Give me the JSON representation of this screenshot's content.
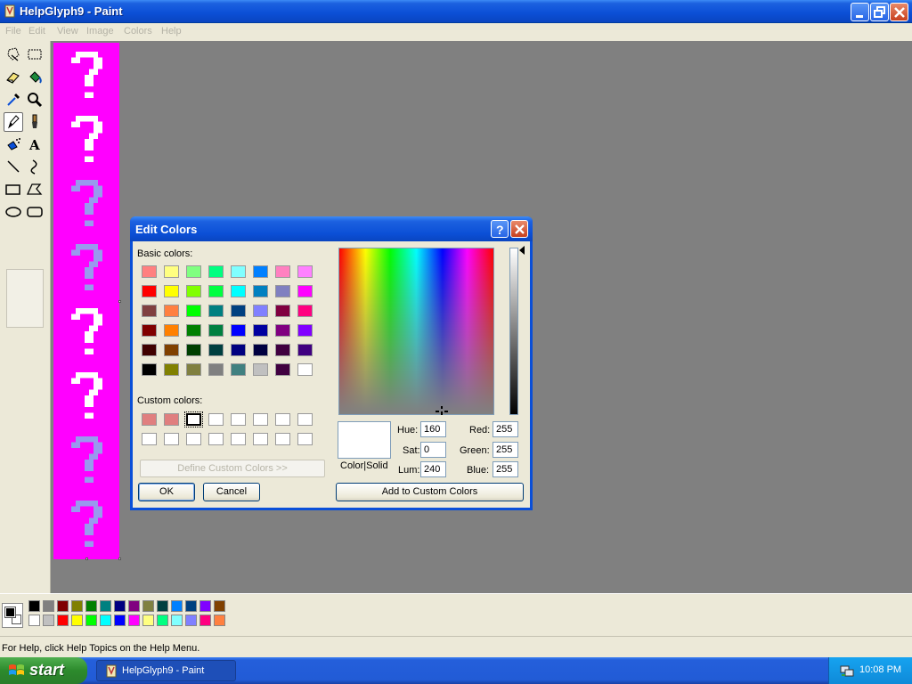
{
  "window": {
    "title": "HelpGlyph9 - Paint"
  },
  "menu": [
    "File",
    "Edit",
    "View",
    "Image",
    "Colors",
    "Help"
  ],
  "tools": [
    "free-form-select",
    "select",
    "eraser",
    "fill",
    "pick-color",
    "magnifier",
    "pencil",
    "brush",
    "airbrush",
    "text",
    "line",
    "curve",
    "rectangle",
    "polygon",
    "ellipse",
    "rounded-rectangle"
  ],
  "status": {
    "text": "For Help, click Help Topics on the Help Menu."
  },
  "palette": {
    "top": [
      "#000000",
      "#808080",
      "#800000",
      "#808000",
      "#008000",
      "#008080",
      "#000080",
      "#800080",
      "#808040",
      "#004040",
      "#0080ff",
      "#004080",
      "#8000ff",
      "#804000"
    ],
    "bottom": [
      "#ffffff",
      "#c0c0c0",
      "#ff0000",
      "#ffff00",
      "#00ff00",
      "#00ffff",
      "#0000ff",
      "#ff00ff",
      "#ffff80",
      "#00ff80",
      "#80ffff",
      "#8080ff",
      "#ff0080",
      "#ff8040"
    ]
  },
  "taskbar": {
    "start_label": "start",
    "task_label": "HelpGlyph9 - Paint",
    "clock": "10:08 PM"
  },
  "dialog": {
    "title": "Edit Colors",
    "basic_colors_label": "Basic colors:",
    "custom_colors_label": "Custom colors:",
    "define_button": "Define Custom Colors >>",
    "ok_label": "OK",
    "cancel_label": "Cancel",
    "color_solid_label": "Color|Solid",
    "add_custom_button": "Add to Custom Colors",
    "hue_label": "Hue:",
    "hue_value": "160",
    "sat_label": "Sat:",
    "sat_value": "0",
    "lum_label": "Lum:",
    "lum_value": "240",
    "red_label": "Red:",
    "red_value": "255",
    "green_label": "Green:",
    "green_value": "255",
    "blue_label": "Blue:",
    "blue_value": "255",
    "basic_colors": [
      [
        "#ff8080",
        "#ffff80",
        "#80ff80",
        "#00ff80",
        "#80ffff",
        "#0080ff",
        "#ff80c0",
        "#ff80ff"
      ],
      [
        "#ff0000",
        "#ffff00",
        "#80ff00",
        "#00ff40",
        "#00ffff",
        "#0080c0",
        "#8080c0",
        "#ff00ff"
      ],
      [
        "#804040",
        "#ff8040",
        "#00ff00",
        "#008080",
        "#004080",
        "#8080ff",
        "#800040",
        "#ff0080"
      ],
      [
        "#800000",
        "#ff8000",
        "#008000",
        "#008040",
        "#0000ff",
        "#0000a0",
        "#800080",
        "#8000ff"
      ],
      [
        "#400000",
        "#804000",
        "#004000",
        "#004040",
        "#000080",
        "#000040",
        "#400040",
        "#400080"
      ],
      [
        "#000000",
        "#808000",
        "#808040",
        "#808080",
        "#408080",
        "#c0c0c0",
        "#400040",
        "#ffffff"
      ]
    ],
    "custom_colors": [
      [
        "#e07f7f",
        "#e07f7f",
        "#ffffff",
        "#ffffff",
        "#ffffff",
        "#ffffff",
        "#ffffff",
        "#ffffff"
      ],
      [
        "#ffffff",
        "#ffffff",
        "#ffffff",
        "#ffffff",
        "#ffffff",
        "#ffffff",
        "#ffffff",
        "#ffffff"
      ]
    ],
    "custom_selected": [
      0,
      2
    ]
  },
  "glyphs": [
    "#ffffff",
    "#ffffff",
    "#9999ee",
    "#9999ee",
    "#ffffff",
    "#ffffff",
    "#9999ee",
    "#9999ee"
  ],
  "colors": {
    "canvas_bg": "#ff00ff",
    "workspace": "#808080"
  }
}
